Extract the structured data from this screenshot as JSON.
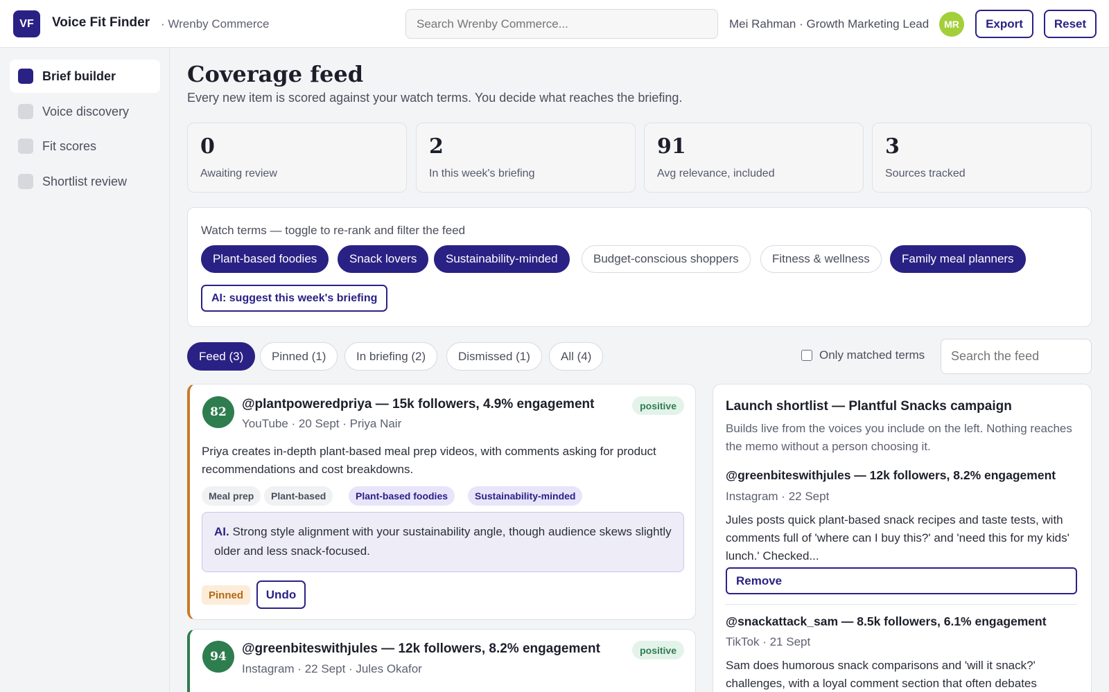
{
  "app": {
    "logo": "VF",
    "title": "Voice Fit Finder",
    "org": "· Wrenby Commerce",
    "search_placeholder": "Search Wrenby Commerce...",
    "user": "Mei Rahman · Growth Marketing Lead",
    "avatar": "MR",
    "export_label": "Export",
    "reset_label": "Reset"
  },
  "sidebar": {
    "items": [
      {
        "label": "Brief builder",
        "active": true
      },
      {
        "label": "Voice discovery",
        "active": false
      },
      {
        "label": "Fit scores",
        "active": false
      },
      {
        "label": "Shortlist review",
        "active": false
      }
    ]
  },
  "page": {
    "title": "Coverage feed",
    "subtitle": "Every new item is scored against your watch terms. You decide what reaches the briefing."
  },
  "stats": [
    {
      "value": "0",
      "label": "Awaiting review"
    },
    {
      "value": "2",
      "label": "In this week's briefing"
    },
    {
      "value": "91",
      "label": "Avg relevance, included"
    },
    {
      "value": "3",
      "label": "Sources tracked"
    }
  ],
  "watch": {
    "label": "Watch terms — toggle to re-rank and filter the feed",
    "terms": [
      {
        "label": "Plant-based foodies",
        "on": true
      },
      {
        "label": "Snack lovers",
        "on": true
      },
      {
        "label": "Sustainability-minded",
        "on": true
      },
      {
        "label": "Budget-conscious shoppers",
        "on": false
      },
      {
        "label": "Fitness & wellness",
        "on": false
      },
      {
        "label": "Family meal planners",
        "on": true
      }
    ],
    "ai_button": "AI: suggest this week's briefing"
  },
  "tabs": [
    {
      "label": "Feed (3)",
      "on": true
    },
    {
      "label": "Pinned (1)",
      "on": false
    },
    {
      "label": "In briefing (2)",
      "on": false
    },
    {
      "label": "Dismissed (1)",
      "on": false
    },
    {
      "label": "All (4)",
      "on": false
    }
  ],
  "filters": {
    "only_matched": "Only matched terms",
    "only_matched_checked": false,
    "search_placeholder": "Search the feed"
  },
  "feed": [
    {
      "score": "82",
      "title": "@plantpoweredpriya — 15k followers, 4.9% engagement",
      "meta": "YouTube · 20 Sept · Priya Nair",
      "sentiment": "positive",
      "body": "Priya creates in-depth plant-based meal prep videos, with comments asking for product recommendations and cost breakdowns.",
      "tags": [
        "Meal prep",
        "Plant-based"
      ],
      "matched_tags": [
        "Plant-based foodies",
        "Sustainability-minded"
      ],
      "ai_prefix": "AI.",
      "ai_note": "Strong style alignment with your sustainability angle, though audience skews slightly older and less snack-focused.",
      "status": "Pinned",
      "undo_label": "Undo"
    },
    {
      "score": "94",
      "title": "@greenbiteswithjules — 12k followers, 8.2% engagement",
      "meta": "Instagram · 22 Sept · Jules Okafor",
      "sentiment": "positive"
    }
  ],
  "shortlist": {
    "title": "Launch shortlist — Plantful Snacks campaign",
    "description": "Builds live from the voices you include on the left. Nothing reaches the memo without a person choosing it.",
    "items": [
      {
        "title": "@greenbiteswithjules — 12k followers, 8.2% engagement",
        "meta": "Instagram · 22 Sept",
        "body": "Jules posts quick plant-based snack recipes and taste tests, with comments full of 'where can I buy this?' and 'need this for my kids' lunch.' Checked...",
        "remove_label": "Remove"
      },
      {
        "title": "@snackattack_sam — 8.5k followers, 6.1% engagement",
        "meta": "TikTok · 21 Sept",
        "body": "Sam does humorous snack comparisons and 'will it snack?' challenges, with a loyal comment section that often debates"
      }
    ]
  },
  "colors": {
    "brand": "#2a2185",
    "positive": "#2e7d4f",
    "pinned": "#c87a28",
    "avatar": "#a3cf3a"
  }
}
